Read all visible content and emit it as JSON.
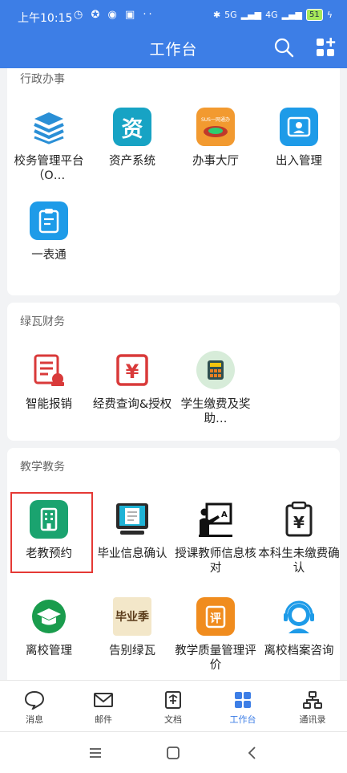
{
  "status_bar": {
    "time": "上午10:15",
    "left_icons": "◷ ✪ ◉ ▣ ··",
    "net1": "5G",
    "net2": "4G",
    "battery": "51"
  },
  "header": {
    "title": "工作台"
  },
  "sections": [
    {
      "title": "行政办事",
      "apps": [
        {
          "label": "校务管理平台（O…",
          "icon": "layers-icon"
        },
        {
          "label": "资产系统",
          "icon": "asset-icon"
        },
        {
          "label": "办事大厅",
          "icon": "service-hall-icon"
        },
        {
          "label": "出入管理",
          "icon": "access-icon"
        },
        {
          "label": "一表通",
          "icon": "form-icon"
        }
      ]
    },
    {
      "title": "绿瓦财务",
      "apps": [
        {
          "label": "智能报销",
          "icon": "reimburse-icon"
        },
        {
          "label": "经费查询&授权",
          "icon": "funds-icon"
        },
        {
          "label": "学生缴费及奖助…",
          "icon": "calculator-icon"
        }
      ]
    },
    {
      "title": "教学教务",
      "apps": [
        {
          "label": "老教预约",
          "icon": "building-icon"
        },
        {
          "label": "毕业信息确认",
          "icon": "graduation-info-icon"
        },
        {
          "label": "授课教师信息核对",
          "icon": "teacher-icon"
        },
        {
          "label": "本科生未缴费确认",
          "icon": "unpaid-icon"
        },
        {
          "label": "离校管理",
          "icon": "graduation-cap-icon"
        },
        {
          "label": "告别绿瓦",
          "icon": "farewell-icon"
        },
        {
          "label": "教学质量管理评价",
          "icon": "evaluation-icon"
        },
        {
          "label": "离校档案咨询",
          "icon": "support-icon"
        }
      ]
    }
  ],
  "icon_text": {
    "asset": "资",
    "hall_banner": "SUS一网通办",
    "yuan": "¥",
    "farewell": "毕业季",
    "evaluate": "评"
  },
  "tabs": [
    {
      "label": "消息",
      "icon": "message-icon"
    },
    {
      "label": "邮件",
      "icon": "mail-icon"
    },
    {
      "label": "文档",
      "icon": "document-icon"
    },
    {
      "label": "工作台",
      "icon": "workbench-icon",
      "active": true
    },
    {
      "label": "通讯录",
      "icon": "contacts-icon"
    }
  ],
  "colors": {
    "brand": "#3d7ee6",
    "highlight": "#e53935"
  }
}
